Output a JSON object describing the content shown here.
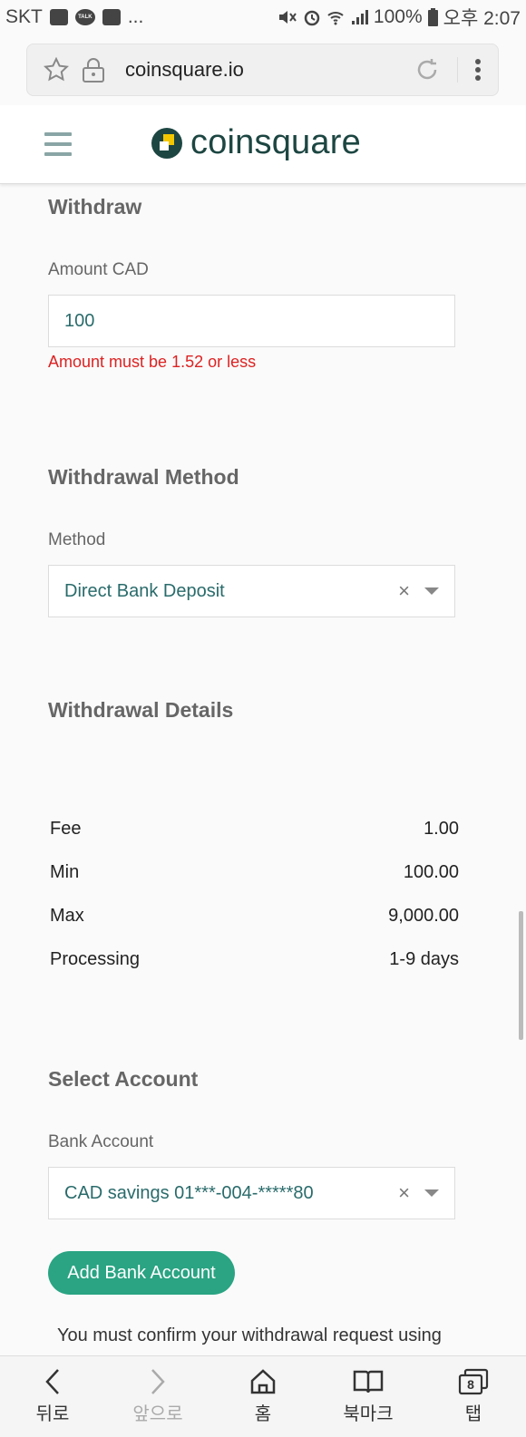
{
  "status_bar": {
    "carrier": "SKT",
    "bubble_label": "TALK",
    "more": "...",
    "battery": "100%",
    "time": "오후 2:07"
  },
  "browser": {
    "url": "coinsquare.io"
  },
  "header": {
    "logo_text": "coinsquare"
  },
  "withdraw": {
    "title": "Withdraw",
    "amount_label": "Amount CAD",
    "amount_value": "100",
    "amount_error": "Amount must be 1.52 or less"
  },
  "method_section": {
    "title": "Withdrawal Method",
    "method_label": "Method",
    "method_value": "Direct Bank Deposit",
    "clear_glyph": "×"
  },
  "details": {
    "title": "Withdrawal Details",
    "rows": [
      {
        "label": "Fee",
        "value": "1.00"
      },
      {
        "label": "Min",
        "value": "100.00"
      },
      {
        "label": "Max",
        "value": "9,000.00"
      },
      {
        "label": "Processing",
        "value": "1-9 days"
      }
    ]
  },
  "account": {
    "title": "Select Account",
    "bank_label": "Bank Account",
    "bank_value": "CAD savings 01***-004-*****80",
    "clear_glyph": "×",
    "add_button": "Add Bank Account",
    "note": "You must confirm your withdrawal request using"
  },
  "bottom_nav": {
    "back": "뒤로",
    "forward": "앞으로",
    "home": "홈",
    "bookmarks": "북마크",
    "tabs": "탭",
    "tab_count": "8"
  },
  "colors": {
    "accent": "#2aa483",
    "error": "#dd2222",
    "brand_dark": "#1d4642",
    "field_text": "#2a6b6b"
  }
}
